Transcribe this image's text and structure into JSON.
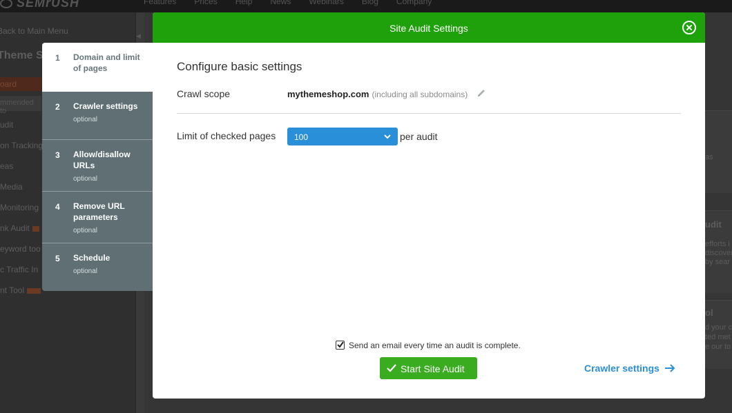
{
  "background": {
    "logo": "SEMrUSH",
    "nav": [
      "Features",
      "Prices",
      "Help",
      "News",
      "Webinars",
      "Blog",
      "Company"
    ],
    "sidebar": {
      "back": "Back to Main Menu",
      "title": "Theme Sh",
      "items": [
        "oard",
        "mmended to",
        "udit",
        "on Tracking",
        "eas",
        "Media",
        "Monitoring",
        "nk Audit",
        "eyword too",
        "c Traffic In",
        "nt Tool"
      ]
    },
    "right_fragments": [
      "as",
      "udit",
      "efforts i",
      "discover",
      "by sear",
      "ol",
      "d your c",
      "ted met",
      "e our to"
    ]
  },
  "stepper": {
    "steps": [
      {
        "num": "1",
        "title": "Domain and limit of pages",
        "sub": ""
      },
      {
        "num": "2",
        "title": "Crawler settings",
        "sub": "optional"
      },
      {
        "num": "3",
        "title": "Allow/disallow URLs",
        "sub": "optional"
      },
      {
        "num": "4",
        "title": "Remove URL parameters",
        "sub": "optional"
      },
      {
        "num": "5",
        "title": "Schedule",
        "sub": "optional"
      }
    ]
  },
  "modal": {
    "title": "Site Audit Settings",
    "section_title": "Configure basic settings",
    "crawl_scope_label": "Crawl scope",
    "domain": "mythemeshop.com",
    "domain_note": "(including all subdomains)",
    "limit_label": "Limit of checked pages",
    "limit_value": "100",
    "per_audit": "per audit",
    "email_checkbox_label": "Send an email every time an audit is complete.",
    "email_checked": true,
    "start_button": "Start Site Audit",
    "crawler_link": "Crawler settings"
  },
  "colors": {
    "header_green": "#1fa10b",
    "button_green": "#3aac1f",
    "accent_blue": "#2a8fd9",
    "stepper_gray": "#5f6f73"
  }
}
